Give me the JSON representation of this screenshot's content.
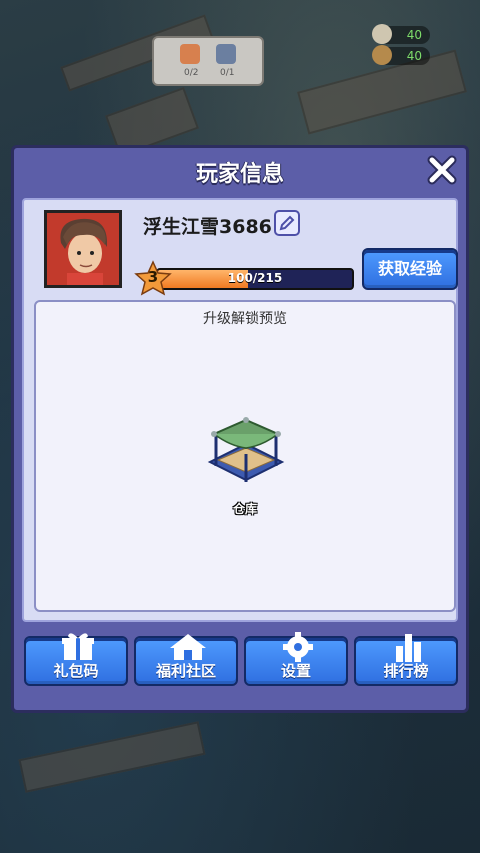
{
  "resources_hud": {
    "request_counts": [
      "0/2",
      "0/1"
    ],
    "top_counts": [
      "40",
      "40"
    ]
  },
  "modal": {
    "title": "玩家信息",
    "close_icon": "close-icon"
  },
  "player": {
    "name": "浮生江雪3686",
    "level": "3",
    "xp_text": "100/215",
    "xp_progress": 0.465,
    "get_exp_label": "获取经验"
  },
  "preview": {
    "title": "升级解锁预览",
    "building_label": "仓库"
  },
  "bottom_buttons": [
    {
      "label": "礼包码",
      "icon": "gift-icon"
    },
    {
      "label": "福利社区",
      "icon": "home-icon"
    },
    {
      "label": "设置",
      "icon": "gear-icon"
    },
    {
      "label": "排行榜",
      "icon": "bar-chart-icon"
    }
  ],
  "colors": {
    "modal_bg": "#5c5ea8",
    "button_blue": "#2f6fe0",
    "xp_fill": "#f07a22",
    "star": "#f29a3a"
  }
}
